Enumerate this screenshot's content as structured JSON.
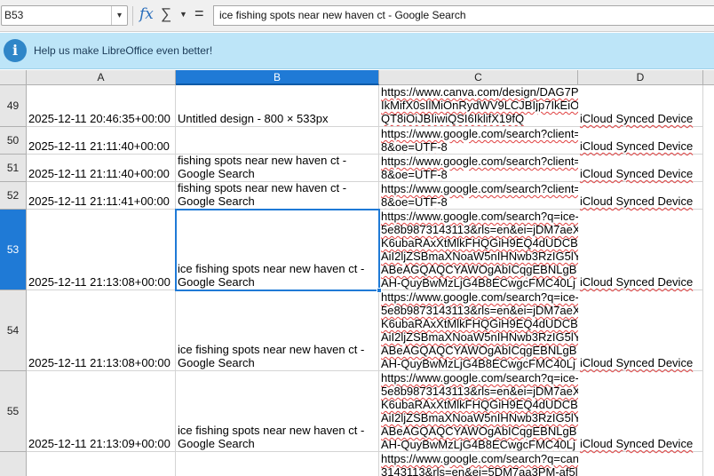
{
  "formula_bar": {
    "namebox": "B53",
    "formula": "ice fishing spots near new haven ct - Google Search"
  },
  "infobar": {
    "message": "Help us make LibreOffice even better!"
  },
  "columns": [
    "A",
    "B",
    "C",
    "D"
  ],
  "rows": [
    {
      "num": "49",
      "a": "2025-12-11 20:46:35+00:00",
      "b": "Untitled design - 800 × 533px",
      "c": "https://www.canva.com/design/DAG7P\nIkMifX0sIlMiOnRydWV9LCJBIjp7IkEiO\nQT8iOiJBIiwiQSI6IklifX19fQ",
      "d": "iCloud Synced Device"
    },
    {
      "num": "50",
      "a": "2025-12-11 21:11:40+00:00",
      "b": "",
      "c": "https://www.google.com/search?client=\n8&oe=UTF-8",
      "d": "iCloud Synced Device"
    },
    {
      "num": "51",
      "a": "2025-12-11 21:11:40+00:00",
      "b": "fishing spots near new haven ct -\nGoogle Search",
      "c": "https://www.google.com/search?client=\n8&oe=UTF-8",
      "d": "iCloud Synced Device"
    },
    {
      "num": "52",
      "a": "2025-12-11 21:11:41+00:00",
      "b": "fishing spots near new haven ct -\nGoogle Search",
      "c": "https://www.google.com/search?client=\n8&oe=UTF-8",
      "d": "iCloud Synced Device"
    },
    {
      "num": "53",
      "a": "2025-12-11 21:13:08+00:00",
      "b": "ice fishing spots near new haven ct -\nGoogle Search",
      "c": "https://www.google.com/search?q=ice-\n5e8b9873143113&rls=en&ei=jDM7aeX\nK6ubaRAxXtMlkFHQGiH9EQ4dUDCB\nAiI2ljZSBmaXNoaW5nIHNwb3RzIG5lY\nABeAGQAQCYAWOgAbICqgEBNLgB\nAH-QuyBwMzLjG4B8ECwgcFMC40Lj",
      "d": "iCloud Synced Device"
    },
    {
      "num": "54",
      "a": "2025-12-11 21:13:08+00:00",
      "b": "ice fishing spots near new haven ct -\nGoogle Search",
      "c": "https://www.google.com/search?q=ice-\n5e8b9873143113&rls=en&ei=jDM7aeX\nK6ubaRAxXtMlkFHQGiH9EQ4dUDCB\nAiI2ljZSBmaXNoaW5nIHNwb3RzIG5lY\nABeAGQAQCYAWOgAbICqgEBNLgB\nAH-QuyBwMzLjG4B8ECwgcFMC40Lj",
      "d": "iCloud Synced Device"
    },
    {
      "num": "55",
      "a": "2025-12-11 21:13:09+00:00",
      "b": "ice fishing spots near new haven ct -\nGoogle Search",
      "c": "https://www.google.com/search?q=ice-\n5e8b9873143113&rls=en&ei=jDM7aeX\nK6ubaRAxXtMlkFHQGiH9EQ4dUDCB\nAiI2ljZSBmaXNoaW5nIHNwb3RzIG5lY\nABeAGQAQCYAWOgAbICqgEBNLgB\nAH-QuyBwMzLjG4B8ECwgcFMC40Lj",
      "d": "iCloud Synced Device"
    },
    {
      "num": "",
      "a": "",
      "b": "",
      "c": "https://www.google.com/search?q=can\n3143113&rls=en&ei=5DM7aa3PM-af5l",
      "d": ""
    }
  ]
}
